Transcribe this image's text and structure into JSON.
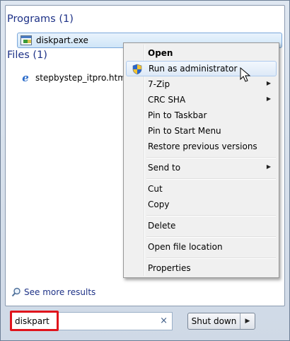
{
  "groups": {
    "programs_header": "Programs (1)",
    "files_header": "Files (1)"
  },
  "programs": [
    {
      "name": "diskpart.exe",
      "icon": "executable-icon"
    }
  ],
  "files": [
    {
      "name": "stepbystep_itpro.htm",
      "icon": "internet-explorer-icon"
    }
  ],
  "see_more": "See more results",
  "search": {
    "value": "diskpart",
    "clear_glyph": "×"
  },
  "shutdown": {
    "label": "Shut down",
    "arrow_glyph": "▶"
  },
  "context_menu": {
    "items": {
      "open": "Open",
      "run_as_admin": "Run as administrator",
      "seven_zip": "7-Zip",
      "crc_sha": "CRC SHA",
      "pin_taskbar": "Pin to Taskbar",
      "pin_start": "Pin to Start Menu",
      "restore": "Restore previous versions",
      "send_to": "Send to",
      "cut": "Cut",
      "copy": "Copy",
      "delete": "Delete",
      "open_location": "Open file location",
      "properties": "Properties"
    },
    "submenu_glyph": "▶",
    "highlighted_item": "run_as_admin"
  },
  "colors": {
    "header_text": "#1e3287",
    "highlight_border": "#e0141c",
    "selection_border": "#7aa7da"
  }
}
